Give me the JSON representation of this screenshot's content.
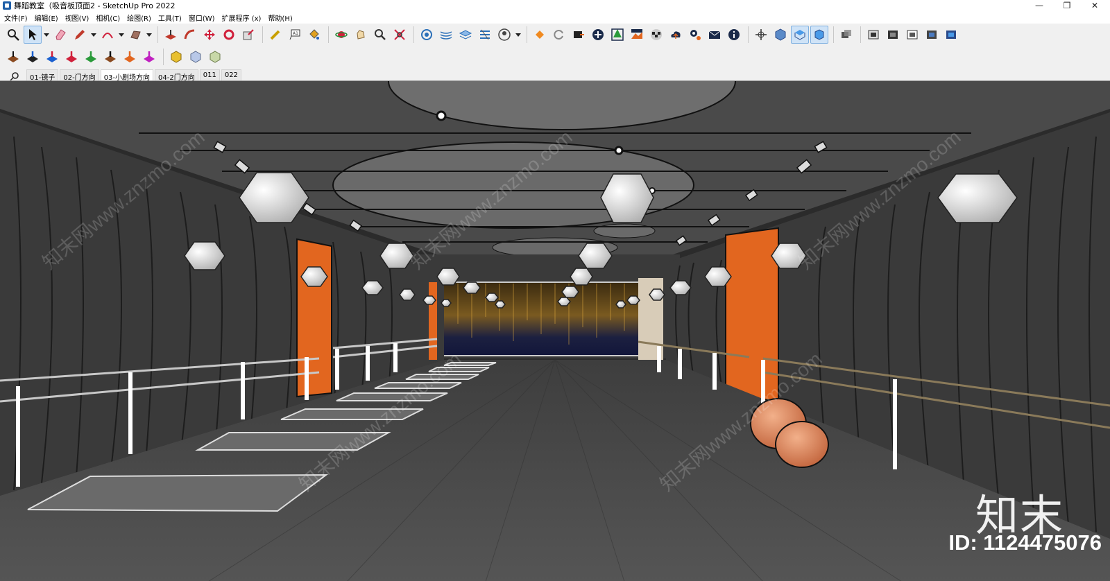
{
  "window": {
    "title": "舞蹈教室（吸音板顶面2 - SketchUp Pro 2022",
    "controls": {
      "minimize": "—",
      "maximize": "❐",
      "close": "✕"
    }
  },
  "menu": [
    "文件(F)",
    "编辑(E)",
    "视图(V)",
    "相机(C)",
    "绘图(R)",
    "工具(T)",
    "窗口(W)",
    "扩展程序 (x)",
    "帮助(H)"
  ],
  "toolbar_row1": [
    "zoom-extents-icon",
    "select-icon",
    "eraser-icon",
    "pencil-icon",
    "arc-icon",
    "rectangle-icon",
    "push-pull-icon",
    "follow-me-icon",
    "move-icon",
    "rotate-icon",
    "scale-icon",
    "tape-measure-icon",
    "text-icon",
    "paint-bucket-icon",
    "orbit-icon",
    "pan-icon",
    "zoom-icon",
    "zoom-window-icon",
    "sandbox-icon",
    "contour-icon",
    "layers-icon",
    "stamp-icon",
    "user-icon",
    "extension-icon",
    "refresh-icon",
    "export-icon",
    "add-icon",
    "tree-icon",
    "terrain-icon",
    "checker-icon",
    "cloud-icon",
    "settings-icon",
    "mail-icon",
    "info-icon",
    "axes-icon",
    "iso-view-icon",
    "top-view-icon",
    "front-view-icon",
    "box-icon",
    "xray-icon",
    "wireframe-icon",
    "hidden-line-icon",
    "shaded-icon",
    "textured-icon",
    "monochrome-icon"
  ],
  "toolbar_row2": [
    "solid-outer-shell-icon",
    "solid-intersect-icon",
    "solid-union-icon",
    "solid-subtract-icon",
    "solid-trim-icon",
    "solid-split-icon",
    "solid-extra-icon",
    "solid-fill-icon",
    "component-icon",
    "group-icon",
    "section-icon"
  ],
  "scenes": {
    "tabs": [
      "01-镜子",
      "02-门方向",
      "03-小剧场方向",
      "04-2门方向",
      "011",
      "022"
    ],
    "active": "03-小剧场方向"
  },
  "watermark": {
    "logo": "知末",
    "id": "ID: 1124475076",
    "text": "知末网www.znzmo.com"
  },
  "colors": {
    "accent_orange": "#e2661f",
    "floor": "#4a4a4a",
    "curtain": "#3a3a3a",
    "stage_screen": "#1c2040"
  }
}
